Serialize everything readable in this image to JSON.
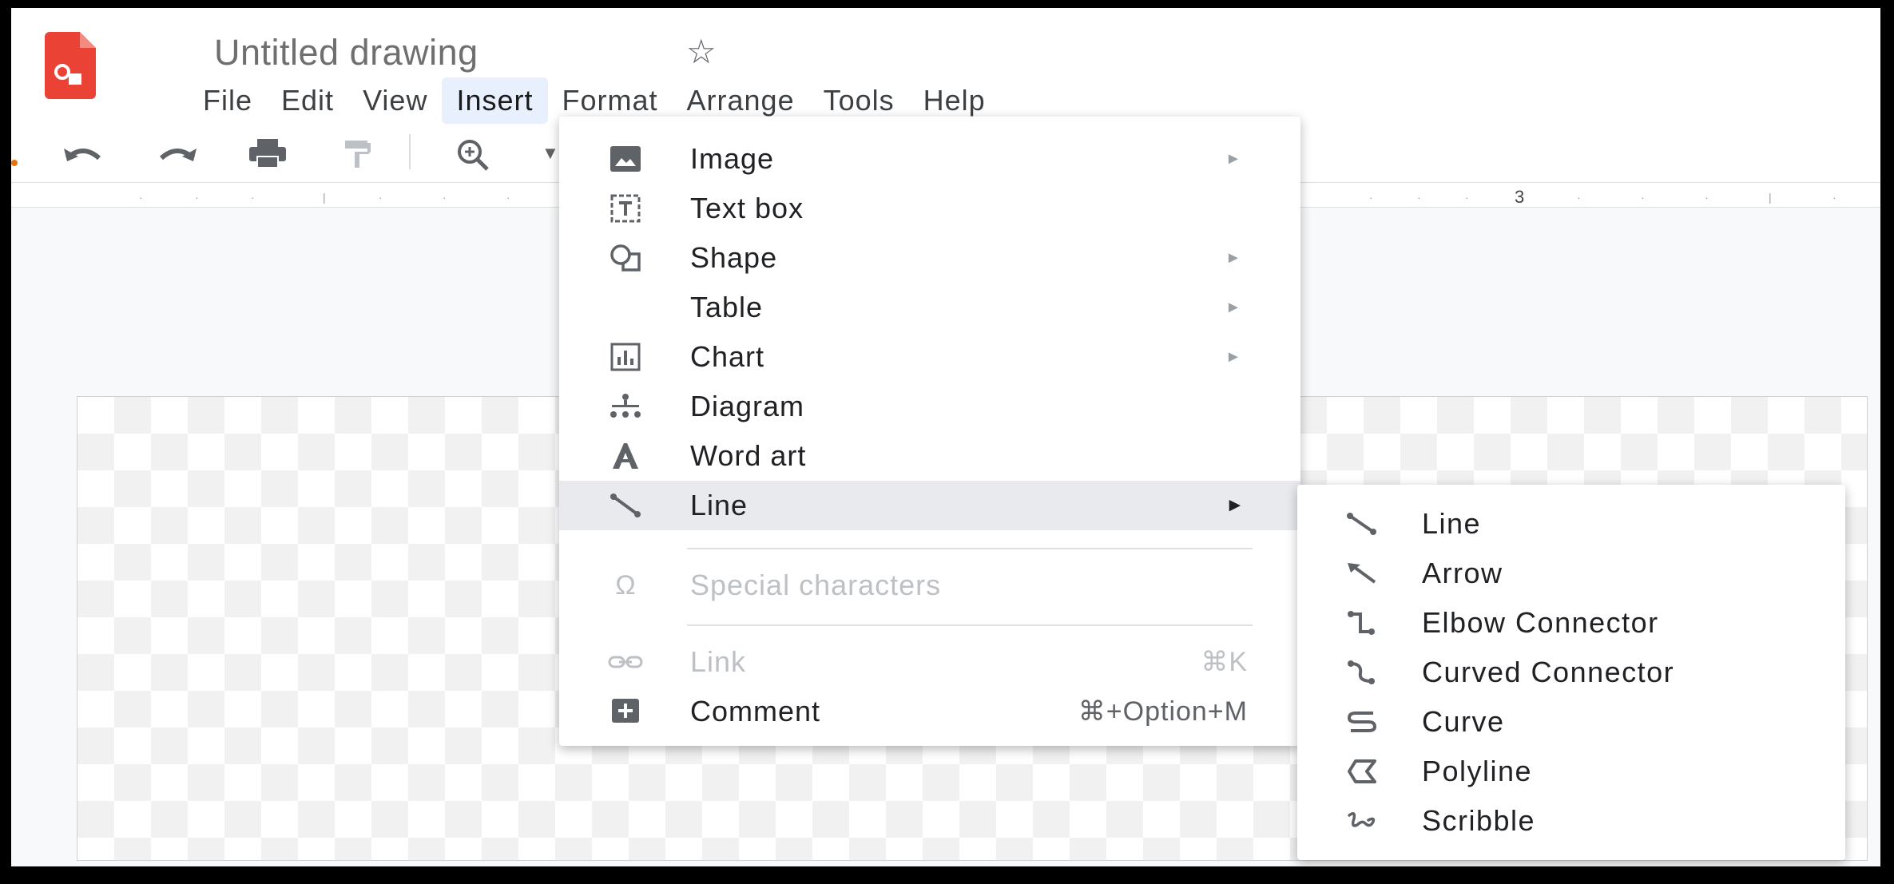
{
  "app": {
    "title": "Untitled drawing",
    "logo_icon": "google-drawings-logo",
    "star_icon": "star-outline-icon",
    "accent_color": "#ea4335"
  },
  "menubar": {
    "items": [
      {
        "label": "File"
      },
      {
        "label": "Edit"
      },
      {
        "label": "View"
      },
      {
        "label": "Insert",
        "active": true
      },
      {
        "label": "Format"
      },
      {
        "label": "Arrange"
      },
      {
        "label": "Tools"
      },
      {
        "label": "Help"
      }
    ]
  },
  "toolbar": {
    "icons": [
      "undo-icon",
      "redo-icon",
      "print-icon",
      "paint-format-icon",
      "zoom-icon",
      "chevron-down-icon"
    ]
  },
  "ruler": {
    "visible_number": "3"
  },
  "insert_menu": {
    "items": [
      {
        "label": "Image",
        "icon": "image-icon",
        "submenu": true
      },
      {
        "label": "Text box",
        "icon": "text-box-icon",
        "submenu": false
      },
      {
        "label": "Shape",
        "icon": "shape-icon",
        "submenu": true
      },
      {
        "label": "Table",
        "icon": "",
        "submenu": true
      },
      {
        "label": "Chart",
        "icon": "chart-icon",
        "submenu": true
      },
      {
        "label": "Diagram",
        "icon": "diagram-icon",
        "submenu": false
      },
      {
        "label": "Word art",
        "icon": "word-art-icon",
        "submenu": false
      },
      {
        "label": "Line",
        "icon": "line-icon",
        "submenu": true,
        "highlighted": true
      },
      {
        "label": "Special characters",
        "icon": "omega-icon",
        "disabled": true
      },
      {
        "label": "Link",
        "icon": "link-icon",
        "disabled": true,
        "shortcut": "⌘K"
      },
      {
        "label": "Comment",
        "icon": "comment-add-icon",
        "shortcut": "⌘+Option+M"
      }
    ]
  },
  "line_submenu": {
    "items": [
      {
        "label": "Line",
        "icon": "line-icon"
      },
      {
        "label": "Arrow",
        "icon": "arrow-icon"
      },
      {
        "label": "Elbow Connector",
        "icon": "elbow-connector-icon"
      },
      {
        "label": "Curved Connector",
        "icon": "curved-connector-icon"
      },
      {
        "label": "Curve",
        "icon": "curve-icon"
      },
      {
        "label": "Polyline",
        "icon": "polyline-icon"
      },
      {
        "label": "Scribble",
        "icon": "scribble-icon"
      }
    ]
  }
}
